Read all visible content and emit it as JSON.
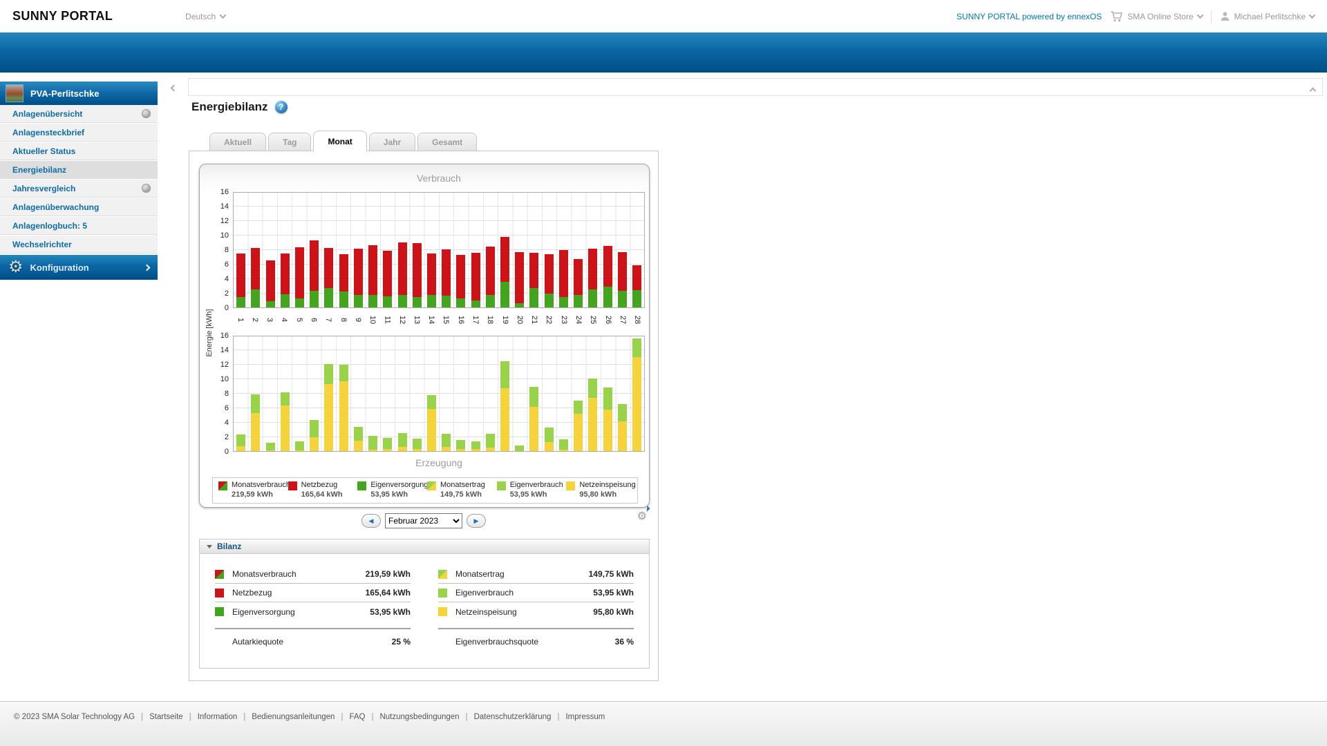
{
  "header": {
    "logo": "SUNNY PORTAL",
    "language": "Deutsch",
    "powered_link": "SUNNY PORTAL powered by ennexOS",
    "store_link": "SMA Online Store",
    "user_name": "Michael Perlitschke"
  },
  "sidebar": {
    "plant_name": "PVA-Perlitschke",
    "items": [
      {
        "label": "Anlagenübersicht",
        "globe": true,
        "active": false
      },
      {
        "label": "Anlagensteckbrief",
        "globe": false,
        "active": false
      },
      {
        "label": "Aktueller Status",
        "globe": false,
        "active": false
      },
      {
        "label": "Energiebilanz",
        "globe": false,
        "active": true
      },
      {
        "label": "Jahresvergleich",
        "globe": true,
        "active": false
      },
      {
        "label": "Anlagenüberwachung",
        "globe": false,
        "active": false
      },
      {
        "label": "Anlagenlogbuch: 5",
        "globe": false,
        "active": false
      },
      {
        "label": "Wechselrichter",
        "globe": false,
        "active": false
      }
    ],
    "config_label": "Konfiguration"
  },
  "page": {
    "title": "Energiebilanz"
  },
  "tabs": [
    {
      "label": "Aktuell",
      "active": false
    },
    {
      "label": "Tag",
      "active": false
    },
    {
      "label": "Monat",
      "active": true
    },
    {
      "label": "Jahr",
      "active": false
    },
    {
      "label": "Gesamt",
      "active": false
    }
  ],
  "period": {
    "selected": "Februar 2023"
  },
  "colors": {
    "red": "#CE1318",
    "green": "#43A41E",
    "light_green": "#99D34A",
    "yellow": "#F5D33B",
    "accent_blue": "#0D6CA6"
  },
  "chart_data": {
    "type": "bar",
    "charts": [
      {
        "title": "Verbrauch",
        "ylabel": "Energie [kWh]",
        "ylim": [
          0,
          16
        ],
        "ytick_step": 2,
        "grid": true,
        "stacking": "series[0] on top, series[1] at bottom",
        "categories": [
          "1",
          "2",
          "3",
          "4",
          "5",
          "6",
          "7",
          "8",
          "9",
          "10",
          "11",
          "12",
          "13",
          "14",
          "15",
          "16",
          "17",
          "18",
          "19",
          "20",
          "21",
          "22",
          "23",
          "24",
          "25",
          "26",
          "27",
          "28"
        ],
        "series": [
          {
            "name": "Netzbezug",
            "color": "#CE1318",
            "values": [
              6.0,
              5.65,
              5.6,
              5.55,
              7.1,
              6.95,
              5.5,
              5.15,
              6.35,
              6.85,
              6.3,
              7.25,
              7.5,
              5.7,
              6.4,
              6.05,
              6.55,
              6.65,
              6.2,
              7.05,
              4.9,
              5.4,
              6.55,
              4.95,
              5.6,
              5.6,
              5.4,
              3.45
            ]
          },
          {
            "name": "Eigenversorgung",
            "color": "#43A41E",
            "values": [
              1.4,
              2.5,
              0.9,
              1.85,
              1.2,
              2.25,
              2.7,
              2.15,
              1.75,
              1.75,
              1.55,
              1.75,
              1.4,
              1.75,
              1.65,
              1.2,
              1.0,
              1.75,
              3.55,
              0.6,
              2.65,
              1.95,
              1.4,
              1.75,
              2.5,
              2.9,
              2.25,
              2.4
            ]
          }
        ]
      },
      {
        "title": "Erzeugung",
        "ylabel": "Energie [kWh]",
        "ylim": [
          0,
          16
        ],
        "ytick_step": 2,
        "grid": true,
        "stacking": "series[0] on top, series[1] at bottom",
        "categories": [
          "1",
          "2",
          "3",
          "4",
          "5",
          "6",
          "7",
          "8",
          "9",
          "10",
          "11",
          "12",
          "13",
          "14",
          "15",
          "16",
          "17",
          "18",
          "19",
          "20",
          "21",
          "22",
          "23",
          "24",
          "25",
          "26",
          "27",
          "28"
        ],
        "series": [
          {
            "name": "Eigenverbrauch",
            "color": "#99D34A",
            "values": [
              1.6,
              2.65,
              1.1,
              1.85,
              1.3,
              2.35,
              2.8,
              2.25,
              1.9,
              1.95,
              1.55,
              1.85,
              1.5,
              1.9,
              1.75,
              1.3,
              1.1,
              1.9,
              3.7,
              0.8,
              2.85,
              2.05,
              1.5,
              1.9,
              2.65,
              3.05,
              2.45,
              2.55
            ]
          },
          {
            "name": "Netzeinspeisung",
            "color": "#F5D33B",
            "values": [
              0.7,
              5.2,
              0.05,
              6.25,
              0.05,
              1.95,
              9.2,
              9.65,
              1.45,
              0.15,
              0.25,
              0.6,
              0.25,
              5.85,
              0.6,
              0.25,
              0.25,
              0.45,
              8.7,
              0.0,
              6.05,
              1.2,
              0.15,
              5.1,
              7.35,
              5.75,
              4.05,
              13.0
            ]
          }
        ]
      }
    ]
  },
  "legend": {
    "items": [
      {
        "label": "Monatsverbrauch",
        "value": "219,59 kWh",
        "chip": "consumption"
      },
      {
        "label": "Netzbezug",
        "value": "165,64 kWh",
        "chip": "grid_purchase"
      },
      {
        "label": "Eigenversorgung",
        "value": "53,95 kWh",
        "chip": "self_supply"
      },
      {
        "label": "Monatsertrag",
        "value": "149,75 kWh",
        "chip": "yield"
      },
      {
        "label": "Eigenverbrauch",
        "value": "53,95 kWh",
        "chip": "self_consumption"
      },
      {
        "label": "Netzeinspeisung",
        "value": "95,80 kWh",
        "chip": "feed_in"
      }
    ]
  },
  "bilanz": {
    "title": "Bilanz",
    "left_rows": [
      {
        "label": "Monatsverbrauch",
        "value": "219,59 kWh",
        "chip": "consumption"
      },
      {
        "label": "Netzbezug",
        "value": "165,64 kWh",
        "chip": "grid_purchase"
      },
      {
        "label": "Eigenversorgung",
        "value": "53,95 kWh",
        "chip": "self_supply"
      }
    ],
    "right_rows": [
      {
        "label": "Monatsertrag",
        "value": "149,75 kWh",
        "chip": "yield"
      },
      {
        "label": "Eigenverbrauch",
        "value": "53,95 kWh",
        "chip": "self_consumption"
      },
      {
        "label": "Netzeinspeisung",
        "value": "95,80 kWh",
        "chip": "feed_in"
      }
    ],
    "quotes_left": {
      "label": "Autarkiequote",
      "value": "25 %"
    },
    "quotes_right": {
      "label": "Eigenverbrauchsquote",
      "value": "36 %"
    }
  },
  "footer": {
    "copyright": "© 2023 SMA Solar Technology AG",
    "links": [
      "Startseite",
      "Information",
      "Bedienungsanleitungen",
      "FAQ",
      "Nutzungsbedingungen",
      "Datenschutzerklärung",
      "Impressum"
    ]
  }
}
